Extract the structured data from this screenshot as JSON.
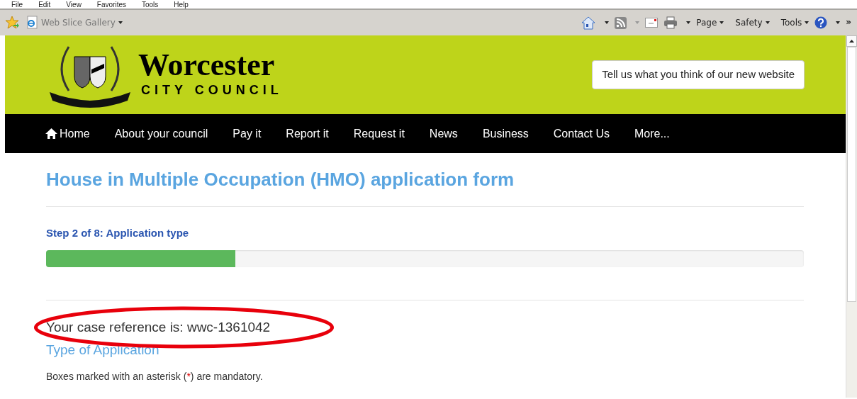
{
  "menu_bar": [
    "File",
    "Edit",
    "View",
    "Favorites",
    "Tools",
    "Help"
  ],
  "toolbar": {
    "web_slice": "Web Slice Gallery",
    "menus": [
      "Page",
      "Safety",
      "Tools"
    ],
    "chevron": "»"
  },
  "header": {
    "title": "Worcester",
    "subtitle": "CITY COUNCIL",
    "feedback_button": "Tell us what you think of our new website"
  },
  "nav": [
    {
      "label": "Home",
      "kind": "home"
    },
    {
      "label": "About your council",
      "kind": "link"
    },
    {
      "label": "Pay it",
      "kind": "link"
    },
    {
      "label": "Report it",
      "kind": "link"
    },
    {
      "label": "Request it",
      "kind": "link"
    },
    {
      "label": "News",
      "kind": "link"
    },
    {
      "label": "Business",
      "kind": "link"
    },
    {
      "label": "Contact Us",
      "kind": "link"
    },
    {
      "label": "More...",
      "kind": "link"
    }
  ],
  "page_title": "House in Multiple Occupation (HMO) application form",
  "step": {
    "label": "Step 2 of 8: Application type",
    "level": 0.25
  },
  "case_reference": "Your case reference is: wwc-1361042",
  "section_title": "Type of Application",
  "mandatory_note": {
    "before": "Boxes marked with an asterisk (",
    "asterisk": "*",
    "after": ") are mandatory."
  }
}
